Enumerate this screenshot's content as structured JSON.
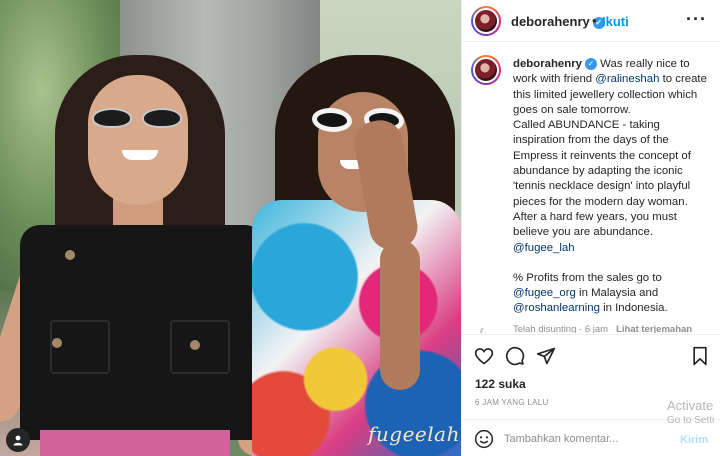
{
  "post": {
    "username": "deborahenry",
    "dot": "•",
    "follow_label": "Ikuti",
    "more_label": "···",
    "watermark": "fugeelah"
  },
  "caption": {
    "username": "deborahenry",
    "t1": "Was really nice to work with friend ",
    "mention_ralineshah": "@ralineshah",
    "t2": " to create this limited jewellery collection which goes on sale tomorrow.",
    "t3": "Called ABUNDANCE - taking inspiration from the days of the Empress it reinvents the concept of abundance by adapting the iconic 'tennis necklace design' into playful pieces for the modern day woman.",
    "t4": "After a hard few years, you must believe you are abundance.",
    "mention_fugee_lah": "@fugee_lah",
    "t5": "% Profits from the sales go to ",
    "mention_fugee_org": "@fugee_org",
    "t6": " in Malaysia and ",
    "mention_roshanlearning": "@roshanlearning",
    "t7": " in Indonesia.",
    "edited": "Telah disunting · 6 jam",
    "translate": "Lihat terjemahan"
  },
  "engagement": {
    "likes": "122 suka",
    "time_ago": "6 JAM YANG LALU"
  },
  "comment_box": {
    "placeholder": "Tambahkan komentar...",
    "post_label": "Kirim"
  },
  "os_watermark": {
    "line1": "Activate",
    "line2": "Go to Setti"
  },
  "icons": {
    "header": [
      "verified-badge-icon",
      "more-options-icon"
    ],
    "actions": [
      "heart-icon",
      "comment-icon",
      "share-icon",
      "bookmark-icon"
    ],
    "other": [
      "emoji-icon",
      "user-tag-icon",
      "loading-icon"
    ]
  },
  "colors": {
    "accent_blue": "#0095f6",
    "link": "#00376b",
    "muted": "#8e8e8e",
    "post_disabled": "#b2dffc"
  }
}
